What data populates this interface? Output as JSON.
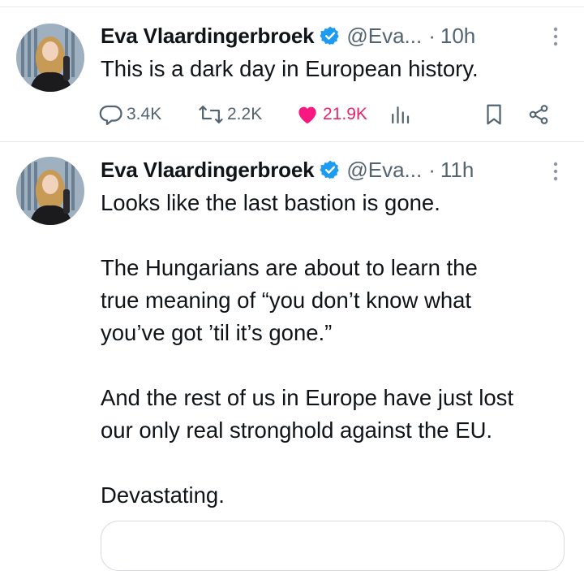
{
  "tweets": [
    {
      "author_name": "Eva Vlaardingerbroek",
      "handle": "@Eva...",
      "separator": "·",
      "time": "10h",
      "text": "This is a dark day in European history.",
      "actions": {
        "replies": "3.4K",
        "retweets": "2.2K",
        "likes": "21.9K"
      }
    },
    {
      "author_name": "Eva Vlaardingerbroek",
      "handle": "@Eva...",
      "separator": "·",
      "time": "11h",
      "text": "Looks like the last bastion is gone.\n\nThe Hungarians are about to learn the\ntrue meaning of “you don’t know what\nyou’ve got ’til it’s gone.”\n\nAnd the rest of us in Europe have just lost\nour only real stronghold against the EU.\n\nDevastating."
    }
  ],
  "colors": {
    "verified": "#1d9bf0",
    "like_active": "#f91880",
    "muted": "#536471",
    "text": "#0f1419"
  },
  "icons": [
    "verified-badge-icon",
    "more-options-icon",
    "reply-icon",
    "retweet-icon",
    "like-icon",
    "views-icon",
    "bookmark-icon",
    "share-icon"
  ]
}
